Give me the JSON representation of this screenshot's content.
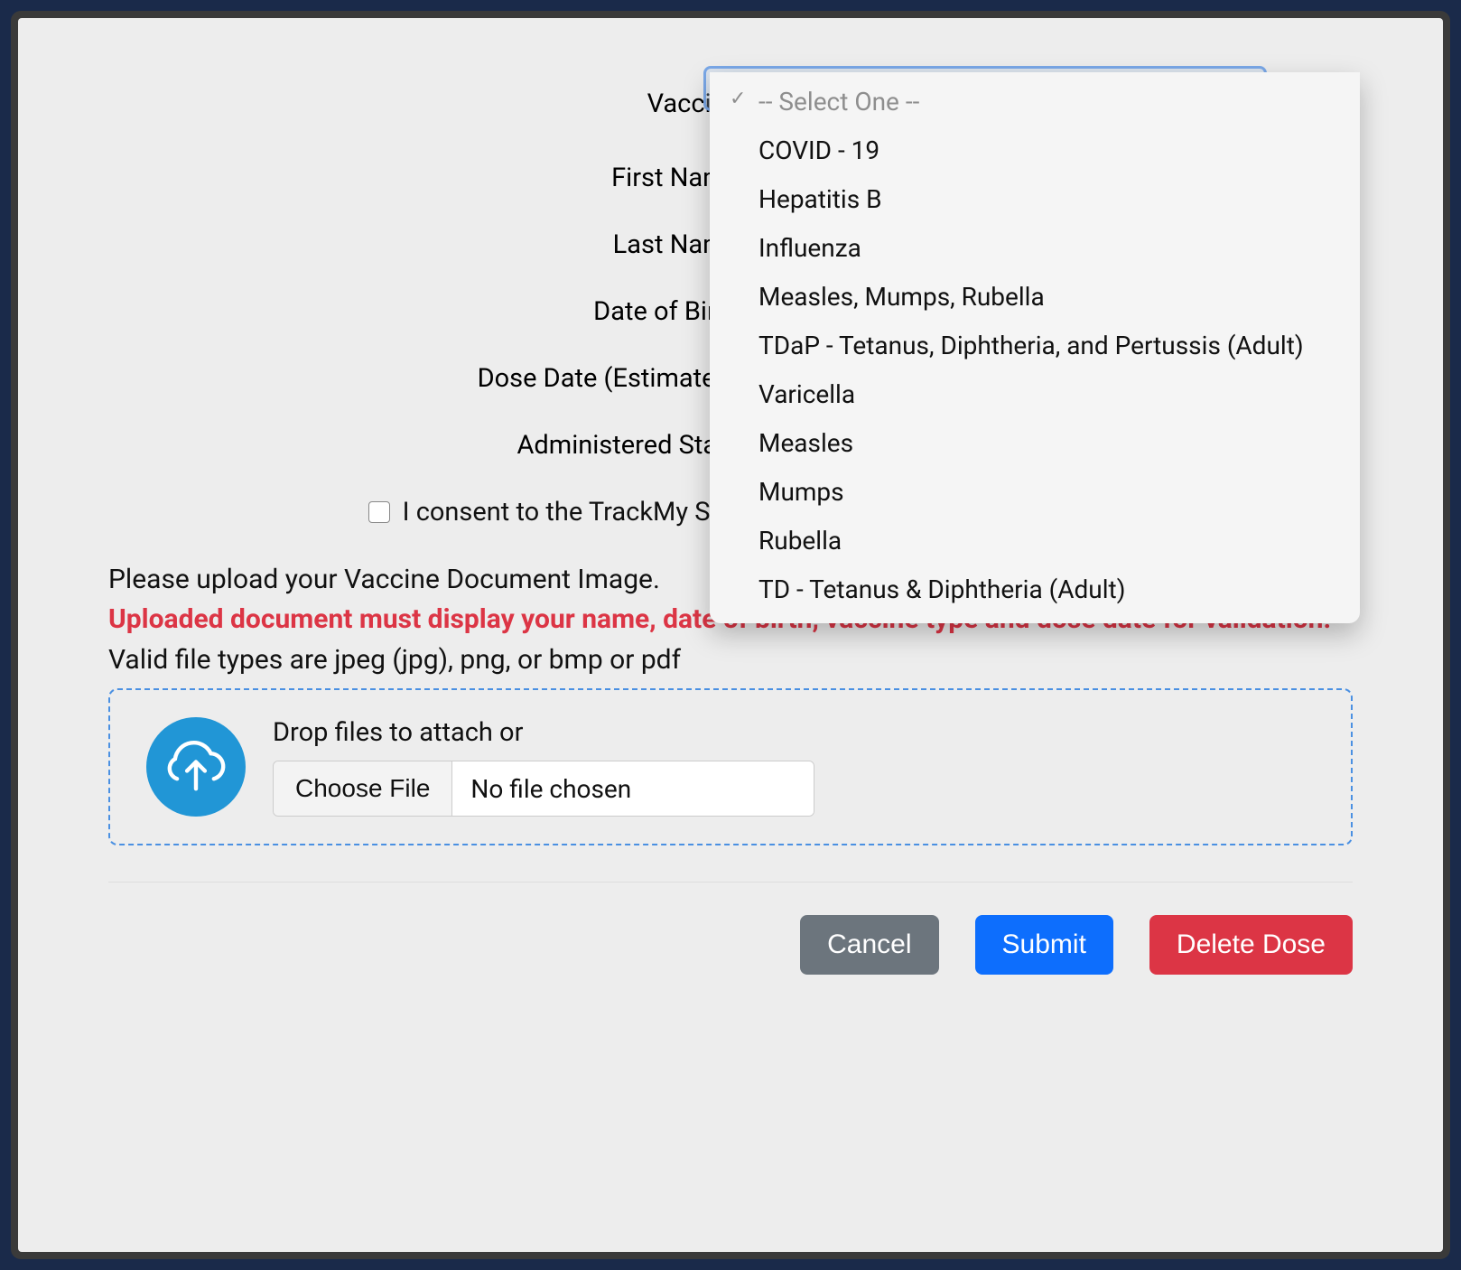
{
  "form": {
    "labels": {
      "vaccine": "Vaccine:",
      "first_name": "First Name:",
      "last_name": "Last Name:",
      "dob": "Date of Birth:",
      "dose_date": "Dose Date (Estimated):",
      "admin_state": "Administered State:"
    },
    "consent_text": "I consent to the TrackMy Solutions Policy and Authorization"
  },
  "dropdown": {
    "placeholder": "-- Select One --",
    "options": [
      "COVID - 19",
      "Hepatitis B",
      "Influenza",
      "Measles, Mumps, Rubella",
      "TDaP - Tetanus, Diphtheria, and Pertussis (Adult)",
      "Varicella",
      "Measles",
      "Mumps",
      "Rubella",
      "TD - Tetanus & Diphtheria (Adult)"
    ]
  },
  "upload": {
    "instruction": "Please upload your Vaccine Document Image.",
    "requirement": "Uploaded document must display your name, date of birth, vaccine type and dose date for validation.",
    "file_types": "Valid file types are jpeg (jpg), png, or bmp or pdf",
    "drop_text": "Drop files to attach or",
    "choose_file": "Choose File",
    "no_file": "No file chosen"
  },
  "buttons": {
    "cancel": "Cancel",
    "submit": "Submit",
    "delete": "Delete Dose"
  }
}
